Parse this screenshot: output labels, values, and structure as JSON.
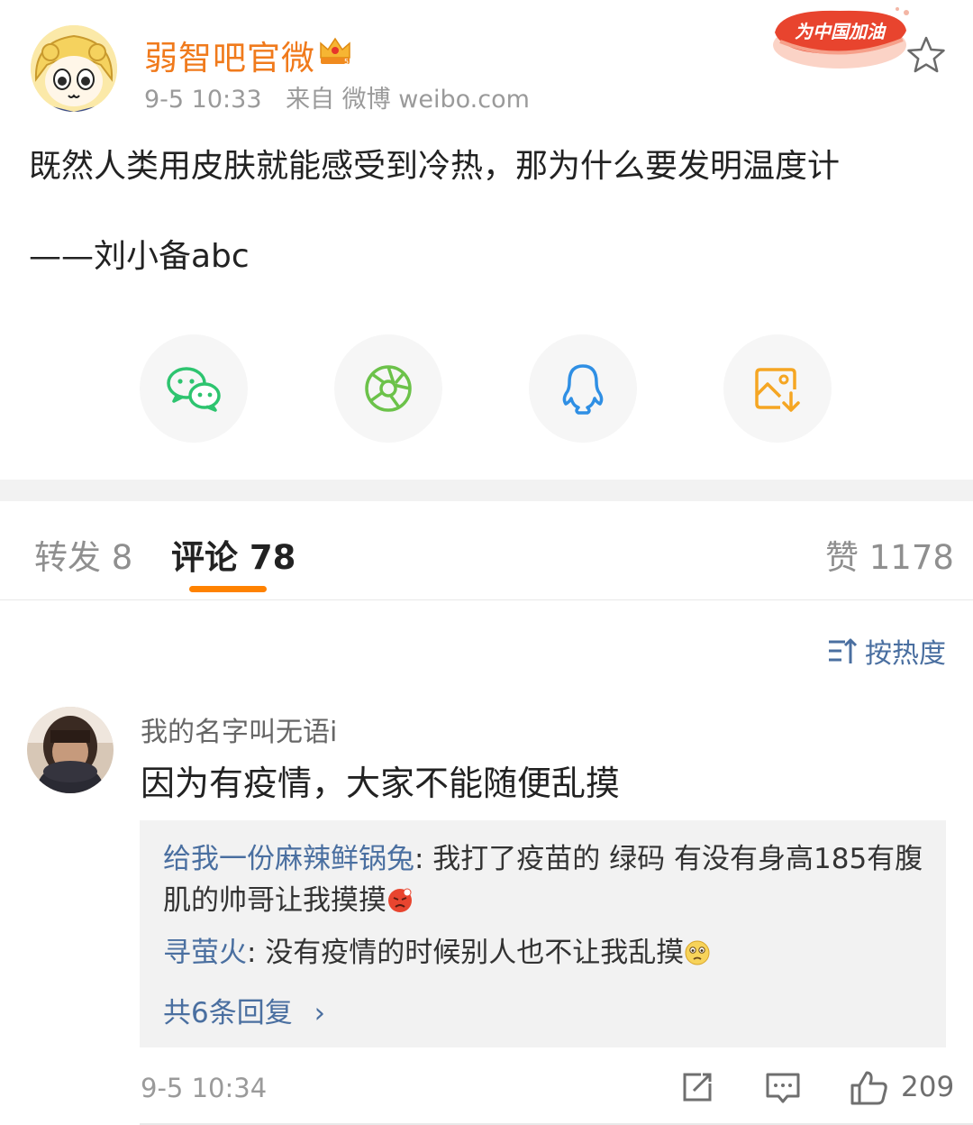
{
  "post": {
    "author": "弱智吧官微",
    "time": "9-5 10:33",
    "source": "来自 微博 weibo.com",
    "badge_text": "为中国加油",
    "text": "既然人类用皮肤就能感受到冷热，那为什么要发明温度计",
    "signature": "——刘小备abc"
  },
  "share_icons": [
    "wechat-icon",
    "moments-icon",
    "qq-icon",
    "save-image-icon"
  ],
  "tabs": {
    "repost": "转发 8",
    "comments": "评论 78",
    "likes": "赞 1178"
  },
  "sort_label": "按热度",
  "comment": {
    "user": "我的名字叫无语i",
    "text": "因为有疫情，大家不能随便乱摸",
    "replies": [
      {
        "user": "给我一份麻辣鲜锅兔",
        "text": ": 我打了疫苗的 绿码 有没有身高185有腹肌的帅哥让我摸摸"
      },
      {
        "user": "寻萤火",
        "text": ": 没有疫情的时候别人也不让我乱摸"
      }
    ],
    "more_replies": "共6条回复",
    "time": "9-5 10:34",
    "like_count": "209"
  },
  "colors": {
    "author": "#f07a1c",
    "link": "#4a6fa0",
    "accent": "#ff8200",
    "wechat": "#2dc46f",
    "qq": "#2f8fe4",
    "save": "#f5a623"
  }
}
